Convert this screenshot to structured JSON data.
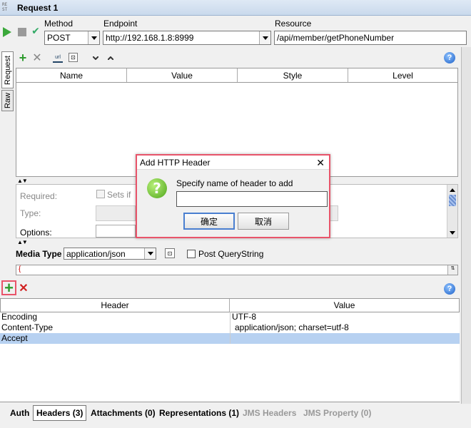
{
  "window": {
    "logo_lines": [
      "RE",
      "ST"
    ],
    "title": "Request 1"
  },
  "toolbar": {
    "method_label": "Method",
    "method_value": "POST",
    "endpoint_label": "Endpoint",
    "endpoint_value": "http://192.168.1.8:8999",
    "resource_label": "Resource",
    "resource_value": "/api/member/getPhoneNumber"
  },
  "side_tabs": {
    "request": "Request",
    "raw": "Raw"
  },
  "params": {
    "columns": [
      "Name",
      "Value",
      "Style",
      "Level"
    ],
    "required_label": "Required:",
    "sets_label": "Sets if",
    "type_label": "Type:",
    "options_label": "Options:",
    "media_type_label": "Media Type",
    "media_type_value": "application/json",
    "post_query_label": "Post QueryString",
    "body_text": "{"
  },
  "dialog": {
    "title": "Add HTTP Header",
    "prompt": "Specify name of header to add",
    "input_value": "",
    "ok_label": "确定",
    "cancel_label": "取消"
  },
  "headers": {
    "columns": [
      "Header",
      "Value"
    ],
    "rows": [
      {
        "name": "Encoding",
        "value": "UTF-8"
      },
      {
        "name": "Content-Type",
        "value": "application/json; charset=utf-8"
      },
      {
        "name": "Accept",
        "value": ""
      }
    ]
  },
  "bottom_tabs": [
    "Auth",
    "Headers (3)",
    "Attachments (0)",
    "Representations (1)",
    "JMS Headers",
    "JMS Property (0)"
  ],
  "colors": {
    "highlight_border": "#e8546a",
    "selected_row": "#b7d1f1",
    "add_green": "#2e9b2e",
    "remove_red": "#d02020"
  }
}
